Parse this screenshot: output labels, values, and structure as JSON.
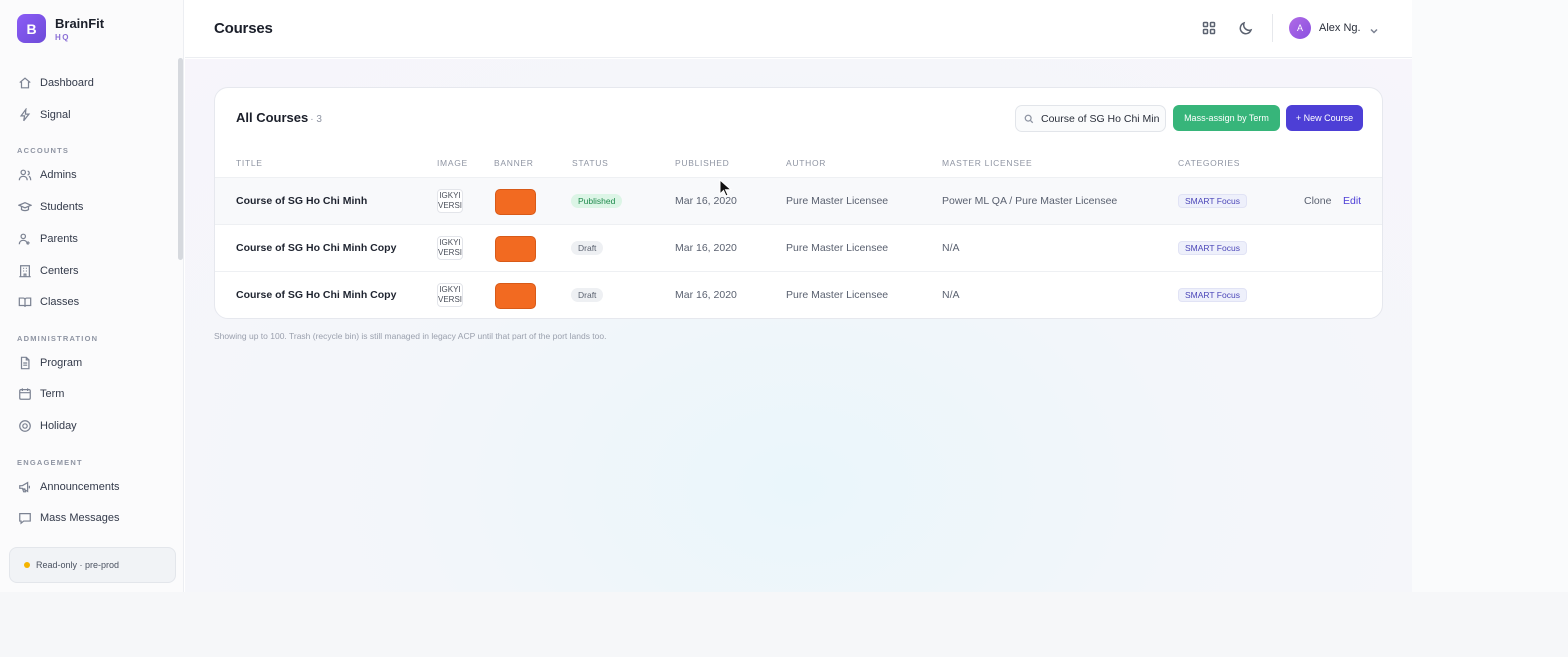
{
  "brand": {
    "logo_letter": "B",
    "name": "BrainFit",
    "sub": "HQ"
  },
  "sidebar": {
    "items_top": [
      {
        "label": "Dashboard",
        "icon": "home-icon"
      },
      {
        "label": "Signal",
        "icon": "lightning-icon"
      }
    ],
    "sections": [
      {
        "title": "ACCOUNTS",
        "items": [
          {
            "label": "Admins",
            "icon": "admin-users-icon"
          },
          {
            "label": "Students",
            "icon": "graduation-cap-icon"
          },
          {
            "label": "Parents",
            "icon": "parents-icon"
          },
          {
            "label": "Centers",
            "icon": "building-icon"
          },
          {
            "label": "Classes",
            "icon": "book-open-icon"
          }
        ]
      },
      {
        "title": "ADMINISTRATION",
        "items": [
          {
            "label": "Program",
            "icon": "document-icon"
          },
          {
            "label": "Term",
            "icon": "calendar-icon"
          },
          {
            "label": "Holiday",
            "icon": "target-icon"
          }
        ]
      },
      {
        "title": "ENGAGEMENT",
        "items": [
          {
            "label": "Announcements",
            "icon": "megaphone-icon"
          },
          {
            "label": "Mass Messages",
            "icon": "message-icon"
          }
        ]
      }
    ],
    "status_badge": "Read-only · pre-prod"
  },
  "header": {
    "page_title": "Courses",
    "user_initial": "A",
    "user_name": "Alex Ng."
  },
  "card": {
    "title": "All Courses",
    "count": "· 3",
    "search_value": "Course of SG Ho Chi Minh",
    "mass_assign_label": "Mass-assign by Term",
    "new_course_label": "+ New Course"
  },
  "table": {
    "columns": [
      "TITLE",
      "IMAGE",
      "BANNER",
      "STATUS",
      "PUBLISHED",
      "AUTHOR",
      "MASTER LICENSEE",
      "CATEGORIES"
    ],
    "rows": [
      {
        "title": "Course of SG Ho Chi Minh",
        "image_text": "IGKYI VERSI",
        "status": "Published",
        "published": "Mar 16, 2020",
        "author": "Pure Master Licensee",
        "licensee": "Power ML QA / Pure Master Licensee",
        "category": "SMART Focus",
        "clone": "Clone",
        "edit": "Edit"
      },
      {
        "title": "Course of SG Ho Chi Minh Copy",
        "image_text": "IGKYI VERSI",
        "status": "Draft",
        "published": "Mar 16, 2020",
        "author": "Pure Master Licensee",
        "licensee": "N/A",
        "category": "SMART Focus"
      },
      {
        "title": "Course of SG Ho Chi Minh Copy",
        "image_text": "IGKYI VERSI",
        "status": "Draft",
        "published": "Mar 16, 2020",
        "author": "Pure Master Licensee",
        "licensee": "N/A",
        "category": "SMART Focus"
      }
    ]
  },
  "footnote": "Showing up to 100. Trash (recycle bin) is still managed in legacy ACP until that part of the port lands too.",
  "colors": {
    "accent": "#4d3fd6",
    "success": "#37b57a",
    "banner": "#f26a21"
  }
}
